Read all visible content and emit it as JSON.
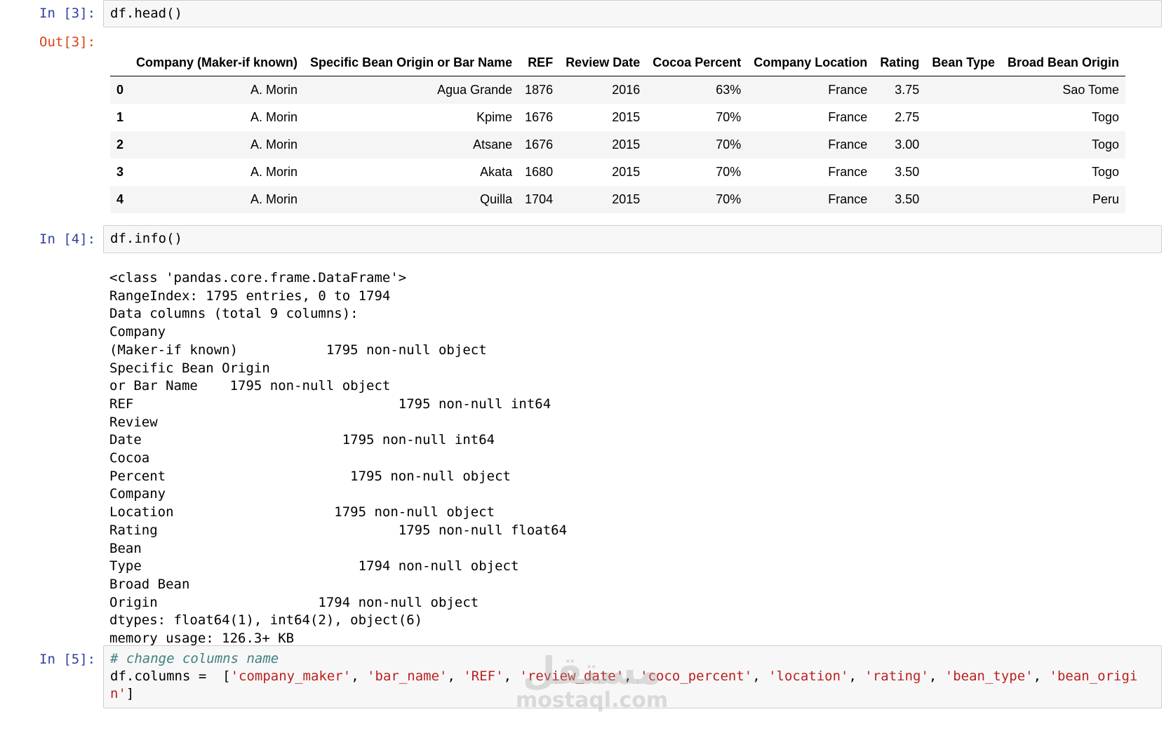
{
  "cells": {
    "cell3": {
      "in_prompt": "In [3]:",
      "out_prompt": "Out[3]:",
      "code": "df.head()"
    },
    "cell4": {
      "in_prompt": "In [4]:",
      "code": "df.info()"
    },
    "cell5": {
      "in_prompt": "In [5]:",
      "comment": "# change columns name",
      "code_prefix": "df.columns =  [",
      "strings": [
        "'company_maker'",
        "'bar_name'",
        "'REF'",
        "'review_date'",
        "'coco_percent'",
        "'location'",
        "'rating'",
        "'bean_type'",
        "'bean_origi"
      ],
      "sep": ", ",
      "line2_string": "n'",
      "line2_suffix": "]"
    }
  },
  "table": {
    "columns": [
      "",
      "Company  (Maker-if known)",
      "Specific Bean Origin or Bar Name",
      "REF",
      "Review Date",
      "Cocoa Percent",
      "Company Location",
      "Rating",
      "Bean Type",
      "Broad Bean Origin"
    ],
    "rows": [
      [
        "0",
        "A. Morin",
        "Agua Grande",
        "1876",
        "2016",
        "63%",
        "France",
        "3.75",
        " ",
        "Sao Tome"
      ],
      [
        "1",
        "A. Morin",
        "Kpime",
        "1676",
        "2015",
        "70%",
        "France",
        "2.75",
        " ",
        "Togo"
      ],
      [
        "2",
        "A. Morin",
        "Atsane",
        "1676",
        "2015",
        "70%",
        "France",
        "3.00",
        " ",
        "Togo"
      ],
      [
        "3",
        "A. Morin",
        "Akata",
        "1680",
        "2015",
        "70%",
        "France",
        "3.50",
        " ",
        "Togo"
      ],
      [
        "4",
        "A. Morin",
        "Quilla",
        "1704",
        "2015",
        "70%",
        "France",
        "3.50",
        " ",
        "Peru"
      ]
    ]
  },
  "info_output": "<class 'pandas.core.frame.DataFrame'>\nRangeIndex: 1795 entries, 0 to 1794\nData columns (total 9 columns):\nCompany \n(Maker-if known)           1795 non-null object\nSpecific Bean Origin\nor Bar Name    1795 non-null object\nREF                                 1795 non-null int64\nReview\nDate                         1795 non-null int64\nCocoa\nPercent                       1795 non-null object\nCompany\nLocation                    1795 non-null object\nRating                              1795 non-null float64\nBean\nType                           1794 non-null object\nBroad Bean\nOrigin                    1794 non-null object\ndtypes: float64(1), int64(2), object(6)\nmemory usage: 126.3+ KB",
  "watermark": {
    "arabic": "مستقل",
    "latin": "mostaql.com"
  }
}
